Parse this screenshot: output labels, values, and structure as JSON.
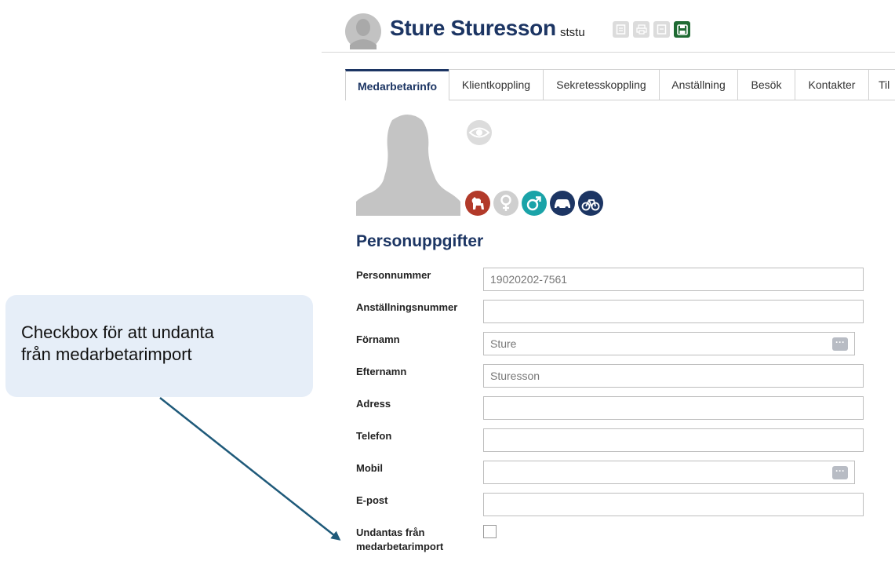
{
  "callout": {
    "line1": "Checkbox för att undanta",
    "line2": "från medarbetarimport"
  },
  "header": {
    "name": "Sture Sturesson",
    "username": "ststu",
    "buttons": [
      "document-icon",
      "print-icon",
      "document-icon",
      "save-icon"
    ]
  },
  "tabs": [
    {
      "label": "Medarbetarinfo",
      "active": true
    },
    {
      "label": "Klientkoppling",
      "active": false
    },
    {
      "label": "Sekretesskoppling",
      "active": false
    },
    {
      "label": "Anställning",
      "active": false
    },
    {
      "label": "Besök",
      "active": false
    },
    {
      "label": "Kontakter",
      "active": false
    },
    {
      "label": "Til",
      "active": false
    }
  ],
  "attributes": [
    {
      "icon": "dog-icon",
      "color": "#b23a2a"
    },
    {
      "icon": "female-icon",
      "color": "#c8c8c8"
    },
    {
      "icon": "male-icon",
      "color": "#1aa3a8"
    },
    {
      "icon": "car-icon",
      "color": "#1c3563"
    },
    {
      "icon": "bicycle-icon",
      "color": "#1c3563"
    }
  ],
  "section_title": "Personuppgifter",
  "fields": {
    "personnummer": {
      "label": "Personnummer",
      "value": "19020202-7561"
    },
    "anstallningsnummer": {
      "label": "Anställningsnummer",
      "value": ""
    },
    "fornamn": {
      "label": "Förnamn",
      "value": "Sture"
    },
    "efternamn": {
      "label": "Efternamn",
      "value": "Sturesson"
    },
    "adress": {
      "label": "Adress",
      "value": ""
    },
    "telefon": {
      "label": "Telefon",
      "value": ""
    },
    "mobil": {
      "label": "Mobil",
      "value": ""
    },
    "epost": {
      "label": "E-post",
      "value": ""
    },
    "undantas": {
      "label_line1": "Undantas från",
      "label_line2": "medarbetarimport",
      "checked": false
    }
  },
  "dots_label": "···",
  "colors": {
    "brand": "#1c3563",
    "save": "#1f6b33",
    "callout_bg": "#e6eef8",
    "arrow": "#1f5a7a"
  }
}
